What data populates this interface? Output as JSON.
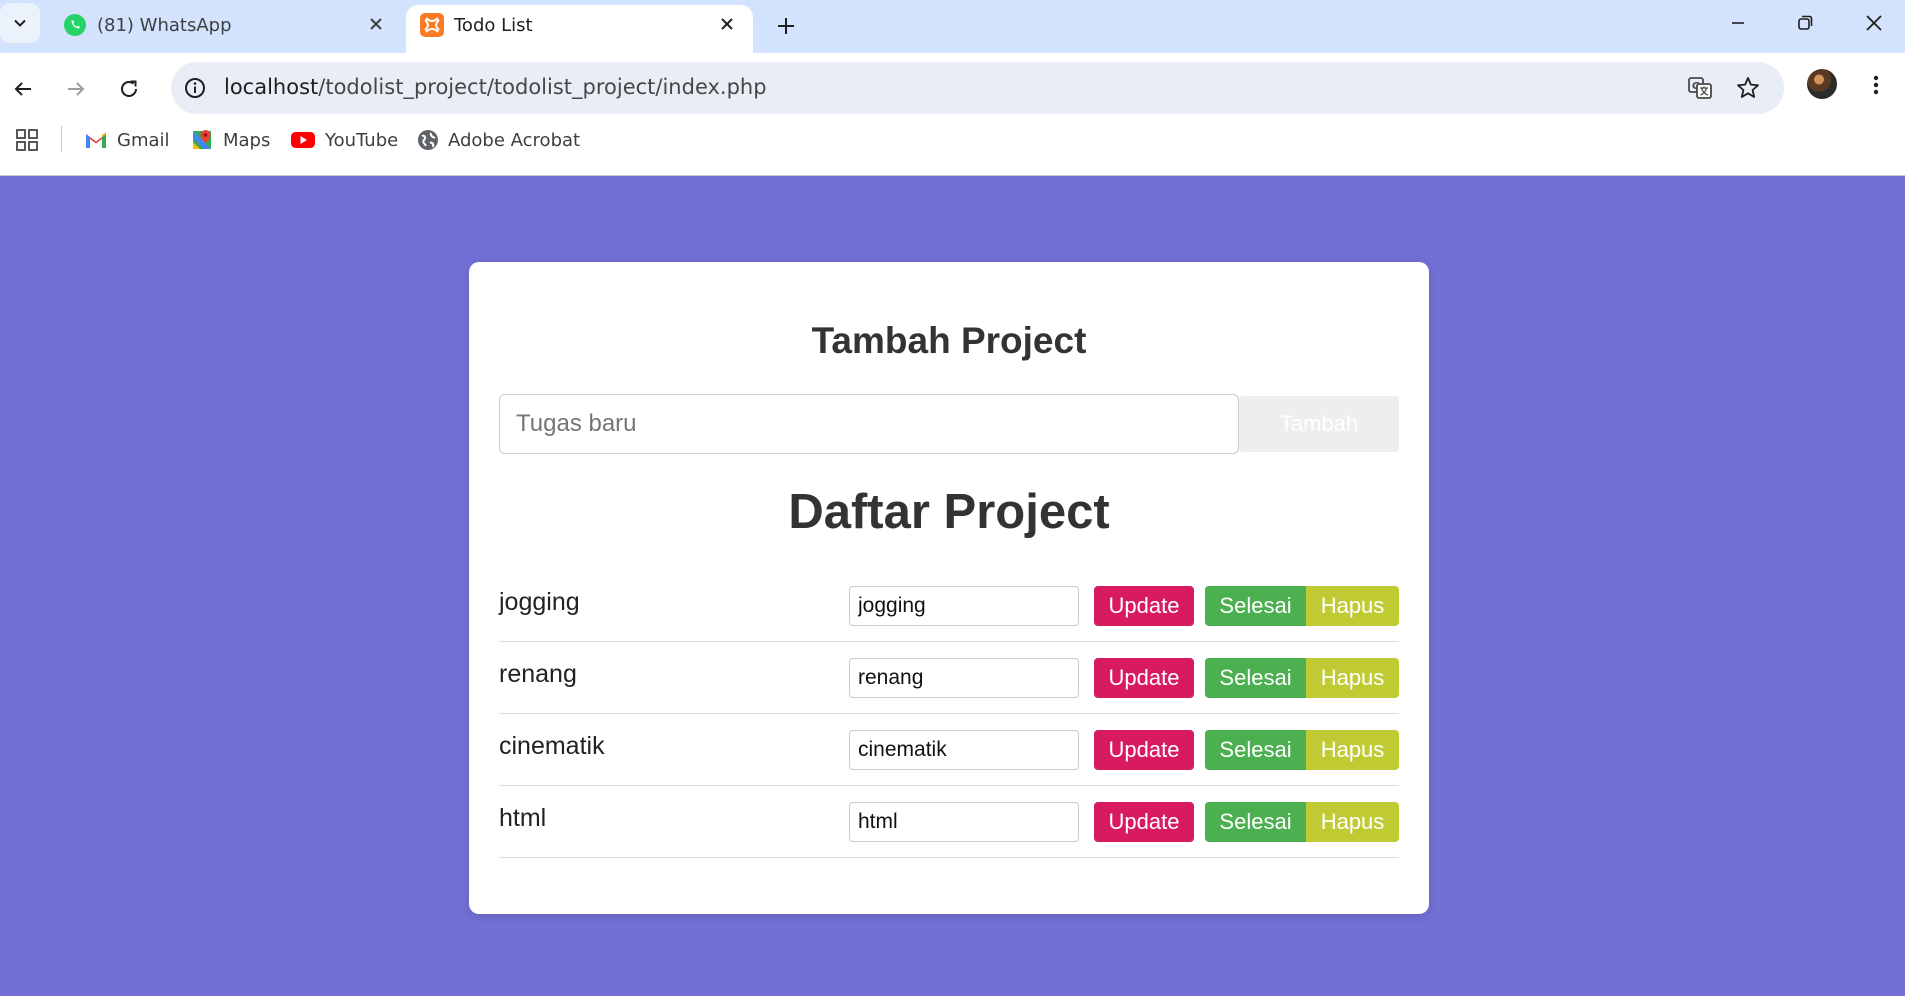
{
  "browser": {
    "tabs": [
      {
        "title": "(81) WhatsApp",
        "icon": "whatsapp-icon",
        "active": false
      },
      {
        "title": "Todo List",
        "icon": "xampp-icon",
        "active": true
      }
    ],
    "url_host": "localhost",
    "url_path": "/todolist_project/todolist_project/index.php",
    "bookmarks": [
      {
        "label": "Gmail",
        "icon": "gmail-icon"
      },
      {
        "label": "Maps",
        "icon": "maps-icon"
      },
      {
        "label": "YouTube",
        "icon": "youtube-icon"
      },
      {
        "label": "Adobe Acrobat",
        "icon": "globe-icon"
      }
    ]
  },
  "colors": {
    "page_background": "#7270d6",
    "update": "#d81b60",
    "done": "#4caf50",
    "delete": "#c0ca33"
  },
  "add_section": {
    "heading": "Tambah Project",
    "placeholder": "Tugas baru",
    "value": "",
    "button_label": "Tambah"
  },
  "list_section": {
    "heading": "Daftar Project",
    "items": [
      {
        "name": "jogging",
        "edit_value": "jogging",
        "update_label": "Update",
        "done_label": "Selesai",
        "delete_label": "Hapus"
      },
      {
        "name": "renang",
        "edit_value": "renang",
        "update_label": "Update",
        "done_label": "Selesai",
        "delete_label": "Hapus"
      },
      {
        "name": "cinematik",
        "edit_value": "cinematik",
        "update_label": "Update",
        "done_label": "Selesai",
        "delete_label": "Hapus"
      },
      {
        "name": "html",
        "edit_value": "html",
        "update_label": "Update",
        "done_label": "Selesai",
        "delete_label": "Hapus"
      }
    ]
  }
}
